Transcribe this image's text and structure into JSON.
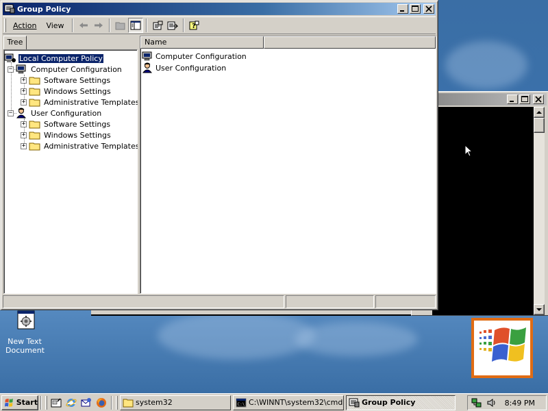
{
  "window": {
    "title": "Group Policy",
    "menus": [
      {
        "label": "Action",
        "accel": "A"
      },
      {
        "label": "View",
        "accel": "V"
      }
    ]
  },
  "tree": {
    "tab_label": "Tree",
    "root": "Local Computer Policy",
    "nodes": [
      {
        "label": "Computer Configuration",
        "icon": "computer-icon"
      },
      {
        "label": "Software Settings",
        "icon": "folder-icon"
      },
      {
        "label": "Windows Settings",
        "icon": "folder-icon"
      },
      {
        "label": "Administrative Templates",
        "icon": "folder-icon"
      },
      {
        "label": "User Configuration",
        "icon": "user-icon"
      },
      {
        "label": "Software Settings",
        "icon": "folder-icon"
      },
      {
        "label": "Windows Settings",
        "icon": "folder-icon"
      },
      {
        "label": "Administrative Templates",
        "icon": "folder-icon"
      }
    ]
  },
  "list": {
    "column_header": "Name",
    "items": [
      {
        "label": "Computer Configuration",
        "icon": "computer-icon"
      },
      {
        "label": "User Configuration",
        "icon": "user-icon"
      }
    ]
  },
  "desktop": {
    "icon_label_line1": "New Text",
    "icon_label_line2": "Document"
  },
  "taskbar": {
    "start_label": "Start",
    "tasks": [
      {
        "label": "system32",
        "icon": "folder-icon"
      },
      {
        "label": "C:\\WINNT\\system32\\cmd...",
        "icon": "console-icon"
      },
      {
        "label": "Group Policy",
        "icon": "group-policy-icon"
      }
    ],
    "clock": "8:49 PM"
  },
  "colors": {
    "desktop": "#3a6ea5",
    "titlebar_active": "#0a246a",
    "face": "#d4d0c8"
  }
}
